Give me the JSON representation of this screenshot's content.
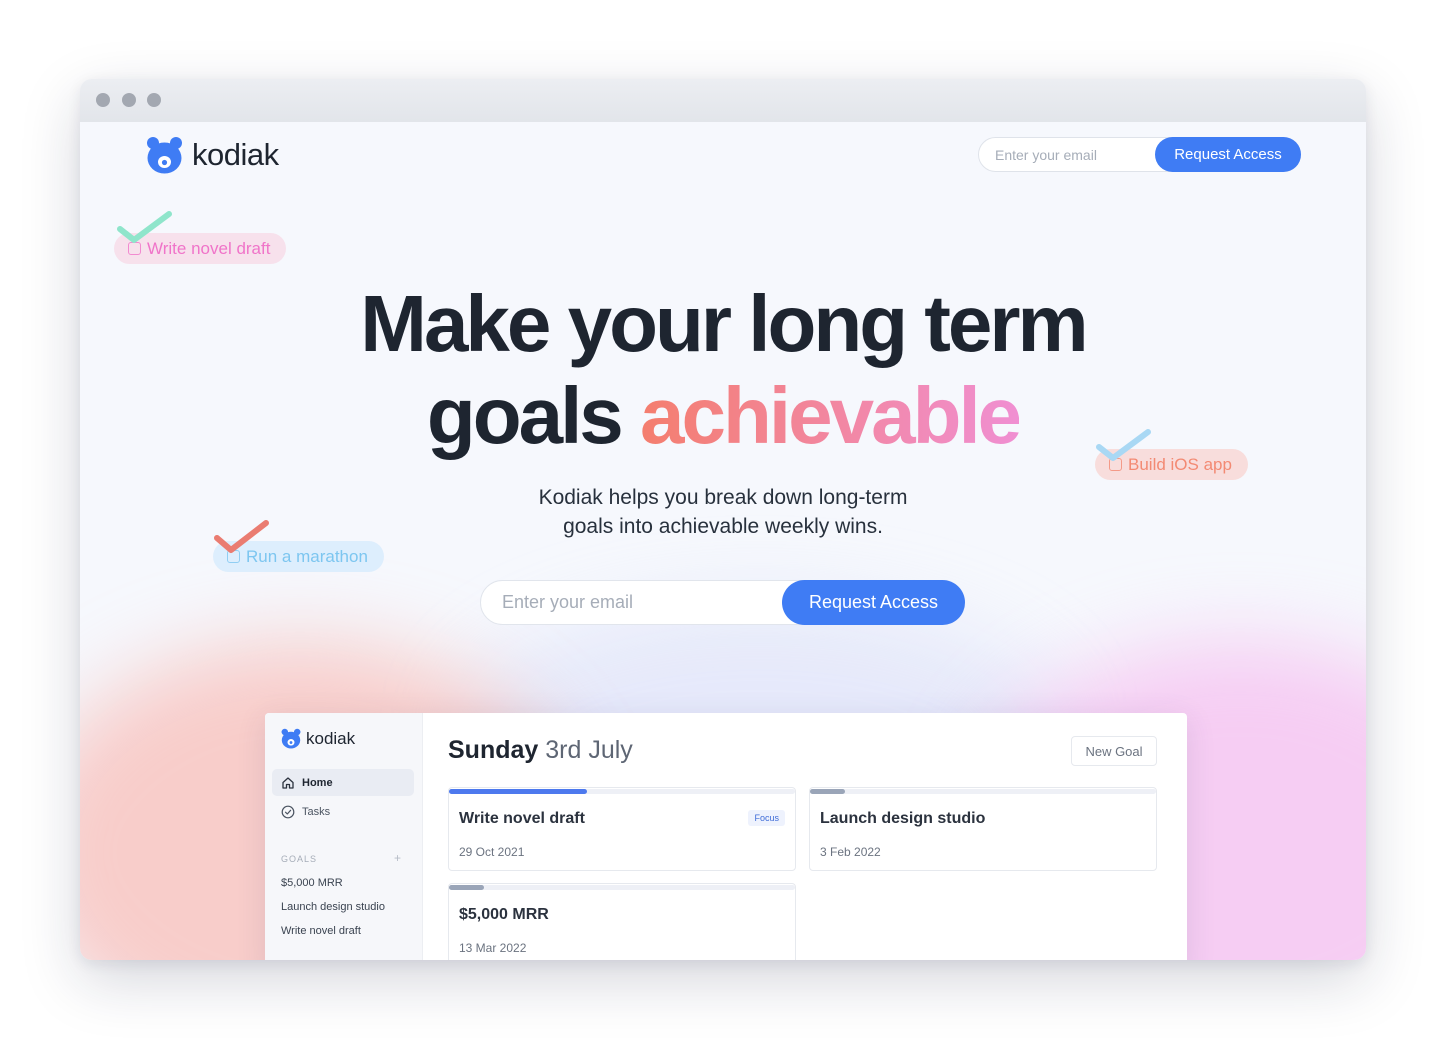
{
  "brand": {
    "name": "kodiak",
    "colors": {
      "primary": "#3f7cf4",
      "dark": "#1e2530",
      "accent_start": "#f47e6e",
      "accent_end": "#f08fd2"
    }
  },
  "window": {
    "controls": [
      "close",
      "minimize",
      "maximize"
    ]
  },
  "header": {
    "email_placeholder": "Enter your email",
    "cta_label": "Request Access"
  },
  "floating_tasks": [
    {
      "label": "Write novel draft",
      "color": "#f074c9",
      "check_color": "#8fe5cb"
    },
    {
      "label": "Build iOS app",
      "color": "#f38a73",
      "check_color": "#a9d8f4"
    },
    {
      "label": "Run a marathon",
      "color": "#7dc6f0",
      "check_color": "#ea7c71"
    }
  ],
  "hero": {
    "line1": "Make your long term",
    "line2_plain": "goals ",
    "line2_accent": "achievable",
    "subtitle_line1": "Kodiak helps you break down long-term",
    "subtitle_line2": "goals into achievable weekly wins.",
    "email_placeholder": "Enter your email",
    "cta_label": "Request Access"
  },
  "app_preview": {
    "logo": "kodiak",
    "nav": [
      {
        "label": "Home",
        "icon": "home-icon",
        "active": true
      },
      {
        "label": "Tasks",
        "icon": "check-circle-icon",
        "active": false
      }
    ],
    "goals_heading": "GOALS",
    "goals_add": "+",
    "goals": [
      "$5,000 MRR",
      "Launch design studio",
      "Write novel draft"
    ],
    "day": "Sunday",
    "date": "3rd July",
    "new_goal_label": "New Goal",
    "cards": [
      {
        "title": "Write novel draft",
        "date": "29 Oct 2021",
        "badge": "Focus",
        "progress": 0.4
      },
      {
        "title": "Launch design studio",
        "date": "3 Feb 2022",
        "badge": "",
        "progress": 0.1
      },
      {
        "title": "$5,000 MRR",
        "date": "13 Mar 2022",
        "badge": "",
        "progress": 0.1
      }
    ]
  }
}
